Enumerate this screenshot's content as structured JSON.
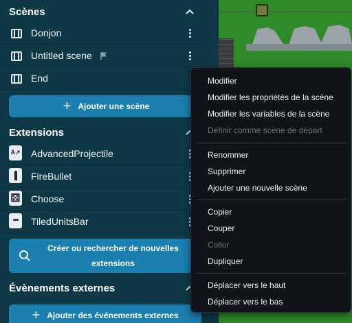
{
  "scenes": {
    "header": "Scènes",
    "items": [
      {
        "label": "Donjon"
      },
      {
        "label": "Untitled scene"
      },
      {
        "label": "End"
      }
    ],
    "add_label": "Ajouter une scène"
  },
  "extensions": {
    "header": "Extensions",
    "items": [
      {
        "label": "AdvancedProjectile"
      },
      {
        "label": "FireBullet"
      },
      {
        "label": "Choose"
      },
      {
        "label": "TiledUnitsBar"
      }
    ],
    "search_label_line1": "Créer ou rechercher de nouvelles",
    "search_label_line2": "extensions"
  },
  "external_events": {
    "header": "Évènements externes",
    "add_label": "Ajouter des événements externes"
  },
  "context_menu": {
    "items": [
      {
        "label": "Modifier",
        "enabled": true
      },
      {
        "label": "Modifier les propriétés de la scène",
        "enabled": true
      },
      {
        "label": "Modifier les variables de la scène",
        "enabled": true
      },
      {
        "label": "Définir comme scène de départ",
        "enabled": false
      },
      {
        "label": "Renommer",
        "enabled": true
      },
      {
        "label": "Supprimer",
        "enabled": true
      },
      {
        "label": "Ajouter une nouvelle scène",
        "enabled": true
      },
      {
        "label": "Copier",
        "enabled": true
      },
      {
        "label": "Couper",
        "enabled": true
      },
      {
        "label": "Coller",
        "enabled": false
      },
      {
        "label": "Dupliquer",
        "enabled": true
      },
      {
        "label": "Déplacer vers le haut",
        "enabled": true
      },
      {
        "label": "Déplacer vers le bas",
        "enabled": true
      }
    ]
  },
  "colors": {
    "panel_bg": "#0f3846",
    "accent_button": "#1b7fb0",
    "menu_bg": "#101418",
    "disabled_text": "#6d7277",
    "preview_grass": "#2f8a2a"
  },
  "icons": {
    "scene": "film-icon",
    "start_scene_flag": "flag-icon",
    "collapse": "chevron-up-icon",
    "more": "kebab-menu-icon",
    "add": "plus-icon",
    "search": "search-icon"
  }
}
